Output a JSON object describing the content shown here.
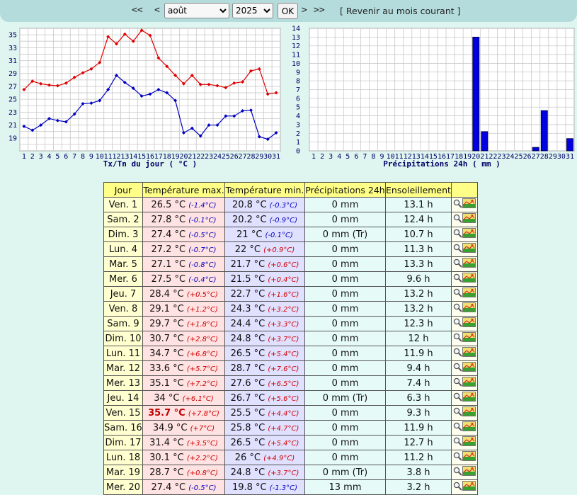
{
  "nav": {
    "prev_year": "<<",
    "prev_month": "<",
    "month_selected": "août",
    "year_selected": "2025",
    "ok_label": "OK",
    "next_month": ">",
    "next_year": ">>",
    "current_month_link": "[ Revenir au mois courant ]"
  },
  "chart_data": [
    {
      "type": "line",
      "title": "",
      "xlabel": "Tx/Tn du jour ( °C )",
      "ylabel": "",
      "x": [
        1,
        2,
        3,
        4,
        5,
        6,
        7,
        8,
        9,
        10,
        11,
        12,
        13,
        14,
        15,
        16,
        17,
        18,
        19,
        20,
        21,
        22,
        23,
        24,
        25,
        26,
        27,
        28,
        29,
        30,
        31
      ],
      "ylim": [
        17,
        36
      ],
      "yticks": [
        19,
        21,
        23,
        25,
        27,
        29,
        31,
        33,
        35
      ],
      "grid": true,
      "series": [
        {
          "key": "tx",
          "color": "#e00000",
          "values": [
            26.5,
            27.8,
            27.4,
            27.2,
            27.1,
            27.5,
            28.4,
            29.1,
            29.7,
            30.7,
            34.7,
            33.6,
            35.1,
            34,
            35.7,
            34.9,
            31.4,
            30.1,
            28.7,
            27.4,
            28.7,
            27.3,
            27.3,
            27.1,
            26.8,
            27.5,
            27.7,
            29.4,
            29.7,
            25.8,
            26.0
          ]
        },
        {
          "key": "tn",
          "color": "#0000c0",
          "values": [
            20.8,
            20.2,
            21,
            22,
            21.7,
            21.5,
            22.7,
            24.3,
            24.4,
            24.8,
            26.5,
            28.7,
            27.6,
            26.7,
            25.5,
            25.8,
            26.5,
            26,
            24.8,
            19.8,
            20.5,
            19.3,
            21,
            21,
            22.4,
            22.4,
            23.2,
            23.3,
            19.2,
            18.8,
            19.8
          ]
        }
      ]
    },
    {
      "type": "bar",
      "title": "",
      "xlabel": "Précipitations 24h ( mm )",
      "ylabel": "",
      "x": [
        1,
        2,
        3,
        4,
        5,
        6,
        7,
        8,
        9,
        10,
        11,
        12,
        13,
        14,
        15,
        16,
        17,
        18,
        19,
        20,
        21,
        22,
        23,
        24,
        25,
        26,
        27,
        28,
        29,
        30,
        31
      ],
      "values": [
        0,
        0,
        0,
        0,
        0,
        0,
        0,
        0,
        0,
        0,
        0,
        0,
        0,
        0,
        0,
        0,
        0,
        0,
        0,
        13,
        2.2,
        0,
        0,
        0,
        0,
        0,
        0.4,
        4.6,
        0,
        0,
        1.4
      ],
      "ylim": [
        0,
        14
      ],
      "yticks": [
        0,
        1,
        2,
        3,
        4,
        5,
        6,
        7,
        8,
        9,
        10,
        11,
        12,
        13,
        14
      ],
      "grid": true,
      "color": "#0000e0"
    }
  ],
  "table": {
    "headers": [
      "Jour",
      "Température max.",
      "Température min.",
      "Précipitations 24h",
      "Ensoleillement",
      ""
    ],
    "rows": [
      {
        "day": "Ven. 1",
        "tx": "26.5 °C",
        "txd": "(-1.4°C)",
        "tn": "20.8 °C",
        "tnd": "(-0.3°C)",
        "pr": "0 mm",
        "sun": "13.1 h"
      },
      {
        "day": "Sam. 2",
        "tx": "27.8 °C",
        "txd": "(-0.1°C)",
        "tn": "20.2 °C",
        "tnd": "(-0.9°C)",
        "pr": "0 mm",
        "sun": "12.4 h"
      },
      {
        "day": "Dim. 3",
        "tx": "27.4 °C",
        "txd": "(-0.5°C)",
        "tn": "21 °C",
        "tnd": "(-0.1°C)",
        "pr": "0 mm (Tr)",
        "sun": "10.7 h"
      },
      {
        "day": "Lun. 4",
        "tx": "27.2 °C",
        "txd": "(-0.7°C)",
        "tn": "22 °C",
        "tnd": "(+0.9°C)",
        "pr": "0 mm",
        "sun": "11.3 h"
      },
      {
        "day": "Mar. 5",
        "tx": "27.1 °C",
        "txd": "(-0.8°C)",
        "tn": "21.7 °C",
        "tnd": "(+0.6°C)",
        "pr": "0 mm",
        "sun": "13.3 h"
      },
      {
        "day": "Mer. 6",
        "tx": "27.5 °C",
        "txd": "(-0.4°C)",
        "tn": "21.5 °C",
        "tnd": "(+0.4°C)",
        "pr": "0 mm",
        "sun": "9.6 h"
      },
      {
        "day": "Jeu. 7",
        "tx": "28.4 °C",
        "txd": "(+0.5°C)",
        "tn": "22.7 °C",
        "tnd": "(+1.6°C)",
        "pr": "0 mm",
        "sun": "13.2 h"
      },
      {
        "day": "Ven. 8",
        "tx": "29.1 °C",
        "txd": "(+1.2°C)",
        "tn": "24.3 °C",
        "tnd": "(+3.2°C)",
        "pr": "0 mm",
        "sun": "13.2 h"
      },
      {
        "day": "Sam. 9",
        "tx": "29.7 °C",
        "txd": "(+1.8°C)",
        "tn": "24.4 °C",
        "tnd": "(+3.3°C)",
        "pr": "0 mm",
        "sun": "12.3 h"
      },
      {
        "day": "Dim. 10",
        "tx": "30.7 °C",
        "txd": "(+2.8°C)",
        "tn": "24.8 °C",
        "tnd": "(+3.7°C)",
        "pr": "0 mm",
        "sun": "12 h"
      },
      {
        "day": "Lun. 11",
        "tx": "34.7 °C",
        "txd": "(+6.8°C)",
        "tn": "26.5 °C",
        "tnd": "(+5.4°C)",
        "pr": "0 mm",
        "sun": "11.9 h"
      },
      {
        "day": "Mar. 12",
        "tx": "33.6 °C",
        "txd": "(+5.7°C)",
        "tn": "28.7 °C",
        "tnd": "(+7.6°C)",
        "pr": "0 mm",
        "sun": "9.4 h"
      },
      {
        "day": "Mer. 13",
        "tx": "35.1 °C",
        "txd": "(+7.2°C)",
        "tn": "27.6 °C",
        "tnd": "(+6.5°C)",
        "pr": "0 mm",
        "sun": "7.4 h"
      },
      {
        "day": "Jeu. 14",
        "tx": "34 °C",
        "txd": "(+6.1°C)",
        "tn": "26.7 °C",
        "tnd": "(+5.6°C)",
        "pr": "0 mm (Tr)",
        "sun": "6.3 h"
      },
      {
        "day": "Ven. 15",
        "tx": "35.7 °C",
        "txd": "(+7.8°C)",
        "tn": "25.5 °C",
        "tnd": "(+4.4°C)",
        "pr": "0 mm",
        "sun": "9.3 h",
        "hot": true
      },
      {
        "day": "Sam. 16",
        "tx": "34.9 °C",
        "txd": "(+7°C)",
        "tn": "25.8 °C",
        "tnd": "(+4.7°C)",
        "pr": "0 mm",
        "sun": "11.9 h"
      },
      {
        "day": "Dim. 17",
        "tx": "31.4 °C",
        "txd": "(+3.5°C)",
        "tn": "26.5 °C",
        "tnd": "(+5.4°C)",
        "pr": "0 mm",
        "sun": "12.7 h"
      },
      {
        "day": "Lun. 18",
        "tx": "30.1 °C",
        "txd": "(+2.2°C)",
        "tn": "26 °C",
        "tnd": "(+4.9°C)",
        "pr": "0 mm",
        "sun": "11.2 h"
      },
      {
        "day": "Mar. 19",
        "tx": "28.7 °C",
        "txd": "(+0.8°C)",
        "tn": "24.8 °C",
        "tnd": "(+3.7°C)",
        "pr": "0 mm (Tr)",
        "sun": "3.8 h"
      },
      {
        "day": "Mer. 20",
        "tx": "27.4 °C",
        "txd": "(-0.5°C)",
        "tn": "19.8 °C",
        "tnd": "(-1.3°C)",
        "pr": "13 mm",
        "sun": "3.2 h"
      }
    ]
  }
}
